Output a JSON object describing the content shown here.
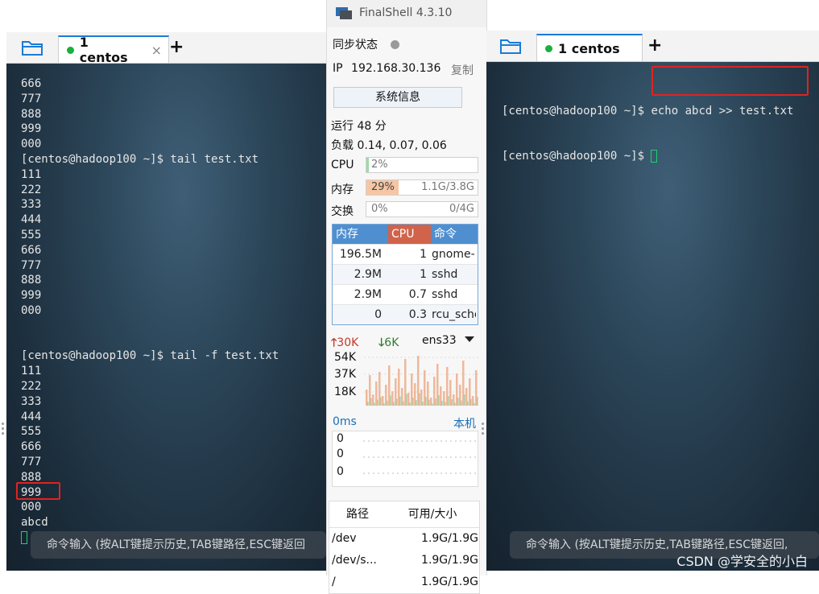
{
  "app": {
    "title": "FinalShell 4.3.10"
  },
  "left_pane": {
    "tab_label": "1 centos",
    "tab_close": "×",
    "new_tab": "+",
    "lines": [
      "666",
      "777",
      "888",
      "999",
      "000",
      "[centos@hadoop100 ~]$ tail test.txt",
      "111",
      "222",
      "333",
      "444",
      "555",
      "666",
      "777",
      "888",
      "999",
      "000",
      "",
      "",
      "[centos@hadoop100 ~]$ tail -f test.txt",
      "111",
      "222",
      "333",
      "444",
      "555",
      "666",
      "777",
      "888",
      "999",
      "000",
      "abcd"
    ],
    "command_input": "命令输入 (按ALT键提示历史,TAB键路径,ESC键返回"
  },
  "right_pane": {
    "tab_label": "1 centos",
    "new_tab": "+",
    "prompt": "[centos@hadoop100 ~]$ ",
    "command": "echo abcd >> test.txt",
    "command_input": "命令输入 (按ALT键提示历史,TAB键路径,ESC键返回,"
  },
  "sidebar": {
    "sync_label": "同步状态",
    "ip_label": "IP",
    "ip_value": "192.168.30.136",
    "copy_label": "复制",
    "sysinfo_button": "系统信息",
    "uptime": "运行 48 分",
    "load": "负载 0.14, 0.07, 0.06",
    "cpu": {
      "label": "CPU",
      "pct_text": "2%",
      "fraction": 0.02,
      "color": "#9fd8a8"
    },
    "mem": {
      "label": "内存",
      "pct_text": "29%",
      "amount": "1.1G/3.8G",
      "fraction": 0.29,
      "color": "#f6c6a4"
    },
    "swap": {
      "label": "交换",
      "pct_text": "0%",
      "amount": "0/4G",
      "fraction": 0.0,
      "color": "#cfe6cf"
    },
    "process_table": {
      "headers": [
        "内存",
        "CPU",
        "命令"
      ],
      "header_colors": [
        "#4f8fd0",
        "#d1634a",
        "#4f8fd0"
      ],
      "rows": [
        [
          "196.5M",
          "1",
          "gnome-"
        ],
        [
          "2.9M",
          "1",
          "sshd"
        ],
        [
          "2.9M",
          "0.7",
          "sshd"
        ],
        [
          "0",
          "0.3",
          "rcu_sche"
        ]
      ]
    },
    "network": {
      "up": "30K",
      "down": "6K",
      "interface": "ens33",
      "y_labels": [
        "54K",
        "37K",
        "18K"
      ],
      "up_color": "#c0392b",
      "down_color": "#2e7d32"
    },
    "ping": {
      "latency": "0ms",
      "host": "本机",
      "values": [
        "0",
        "0",
        "0"
      ]
    },
    "disk": {
      "headers": [
        "路径",
        "可用/大小"
      ],
      "rows": [
        [
          "/dev",
          "1.9G/1.9G"
        ],
        [
          "/dev/s...",
          "1.9G/1.9G"
        ],
        [
          "/",
          "1.9G/1.9G"
        ]
      ]
    }
  },
  "watermark": "CSDN @学安全的小白"
}
